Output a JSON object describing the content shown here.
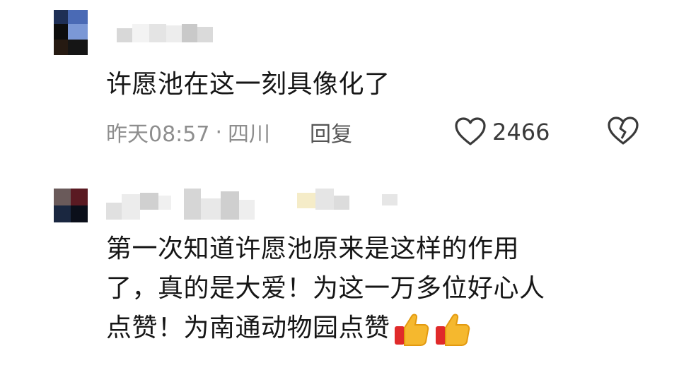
{
  "comments": [
    {
      "text": "许愿池在这一刻具像化了",
      "time": "昨天08:57",
      "separator": "·",
      "location": "四川",
      "reply_label": "回复",
      "likes": "2466"
    },
    {
      "text_line1": "第一次知道许愿池原来是这样的作用",
      "text_line2": "了，真的是大爱！为这一万多位好心人",
      "text_line3": "点赞！为南通动物园点赞"
    }
  ],
  "icons": {
    "like": "heart-outline-icon",
    "dislike": "broken-heart-icon",
    "emoji": "thumbs-up-emoji"
  },
  "colors": {
    "meta_text": "#8e8e8e",
    "text": "#161616"
  }
}
